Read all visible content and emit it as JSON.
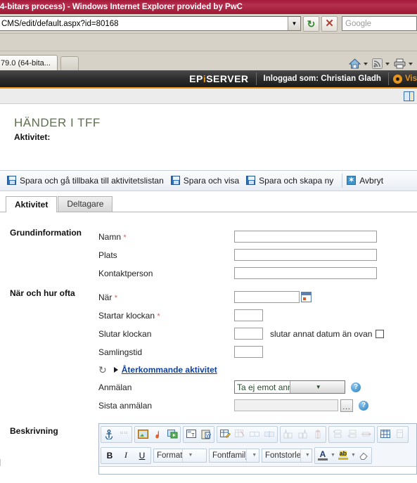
{
  "browser": {
    "title": "4-bitars process) - Windows Internet Explorer provided by PwC",
    "address": "CMS/edit/default.aspx?id=80168",
    "search_placeholder": "Google",
    "tab_label": "79.0 (64-bita...",
    "icons": {
      "address_dropdown": "▼",
      "refresh": "↻",
      "stop": "✕",
      "home": "home-icon",
      "feed": "rss-icon",
      "print": "print-icon"
    }
  },
  "epi_header": {
    "logo_pre": "EP",
    "logo_i": "i",
    "logo_post": "SERVER",
    "user_label": "Inloggad som: Christian Gladh",
    "view_label": "Vis",
    "accent_color": "#e8951d"
  },
  "page": {
    "title": "HÄNDER I TFF",
    "subtitle": "Aktivitet:"
  },
  "toolbar": {
    "save_back_label": "Spara och gå tillbaka till aktivitetslistan",
    "save_show_label": "Spara och visa",
    "save_new_label": "Spara och skapa ny",
    "cancel_label": "Avbryt",
    "cancel_glyph": "✶"
  },
  "tabs": [
    {
      "label": "Aktivitet",
      "active": true
    },
    {
      "label": "Deltagare",
      "active": false
    }
  ],
  "form": {
    "groups": [
      {
        "label": "Grundinformation",
        "fields": [
          {
            "label": "Namn",
            "required": "*",
            "value": ""
          },
          {
            "label": "Plats",
            "required": "",
            "value": ""
          },
          {
            "label": "Kontaktperson",
            "required": "",
            "value": ""
          }
        ]
      },
      {
        "label": "När och hur ofta",
        "fields": [
          {
            "label": "När",
            "required": "*",
            "value": ""
          },
          {
            "label": "Startar klockan",
            "required": "*",
            "value": ""
          },
          {
            "label": "Slutar klockan",
            "required": "",
            "value": ""
          },
          {
            "label": "Samlingstid",
            "required": "",
            "value": ""
          }
        ],
        "checkbox_label": "slutar annat datum än ovan",
        "checkbox_checked": false
      }
    ],
    "recurring_link": "Återkommande aktivitet",
    "recurring_icon": "↻",
    "anmalan_label": "Anmälan",
    "anmalan_value": "Ta ej emot anmälningar",
    "sista_anmalan_label": "Sista anmälan",
    "sista_anmalan_value": "",
    "ellipsis_label": "...",
    "help_glyph": "?"
  },
  "editor": {
    "section_label": "Beskrivning",
    "toolbar_icons_row1": [
      "anchor-icon",
      "quote-icon",
      "insert-image-icon",
      "insert-media-icon",
      "insert-flash-icon",
      "insert-template-icon",
      "paste-from-word-icon",
      "table-wizard-icon",
      "table-properties-icon",
      "merge-cells-icon",
      "split-cell-icon",
      "insert-column-left-icon",
      "insert-column-right-icon",
      "delete-column-icon",
      "insert-row-above-icon",
      "insert-row-below-icon",
      "delete-row-icon",
      "insert-table-icon"
    ],
    "bold_label": "B",
    "italic_label": "I",
    "underline_label": "U",
    "format_label": "Format",
    "fontfamily_label": "Fontfamilj",
    "fontsize_label": "Fontstorlek",
    "fontcolor_label": "A",
    "highlight_label": "ab",
    "eraser_label": "eraser-icon"
  }
}
